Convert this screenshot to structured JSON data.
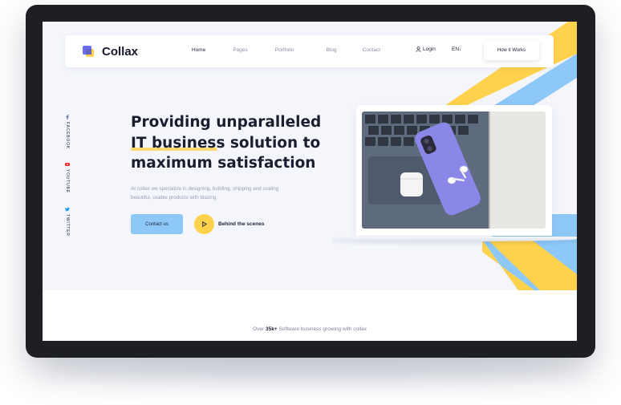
{
  "brand": {
    "name": "Collax"
  },
  "nav": {
    "items": [
      {
        "label": "Home"
      },
      {
        "label": "Pages"
      },
      {
        "label": "Portfolio"
      },
      {
        "label": "Blog"
      },
      {
        "label": "Contact"
      }
    ],
    "active_index": 0,
    "login_label": "Login",
    "lang_label": "EN",
    "cta_label": "How it Works"
  },
  "social": [
    {
      "label": "FACEBOOK",
      "icon": "facebook-icon"
    },
    {
      "label": "YOUTUBE",
      "icon": "youtube-icon"
    },
    {
      "label": "TWITTER",
      "icon": "twitter-icon"
    }
  ],
  "hero": {
    "headline_lines": [
      "Providing unparalleled",
      "IT business solution to",
      "maximum satisfaction"
    ],
    "description": "At collax we specialize in designing, building, shipping and scaling beautiful, usable products with blazing.",
    "primary_button": "Contact us",
    "secondary_label": "Behind the scenes"
  },
  "stats": {
    "prefix": "Over ",
    "count": "35k+",
    "suffix": " Software business growing with collax"
  },
  "colors": {
    "accent_blue": "#8ec8f8",
    "accent_yellow": "#ffd24d",
    "background": "#f4f6fc",
    "device_frame": "#1d1f23"
  }
}
